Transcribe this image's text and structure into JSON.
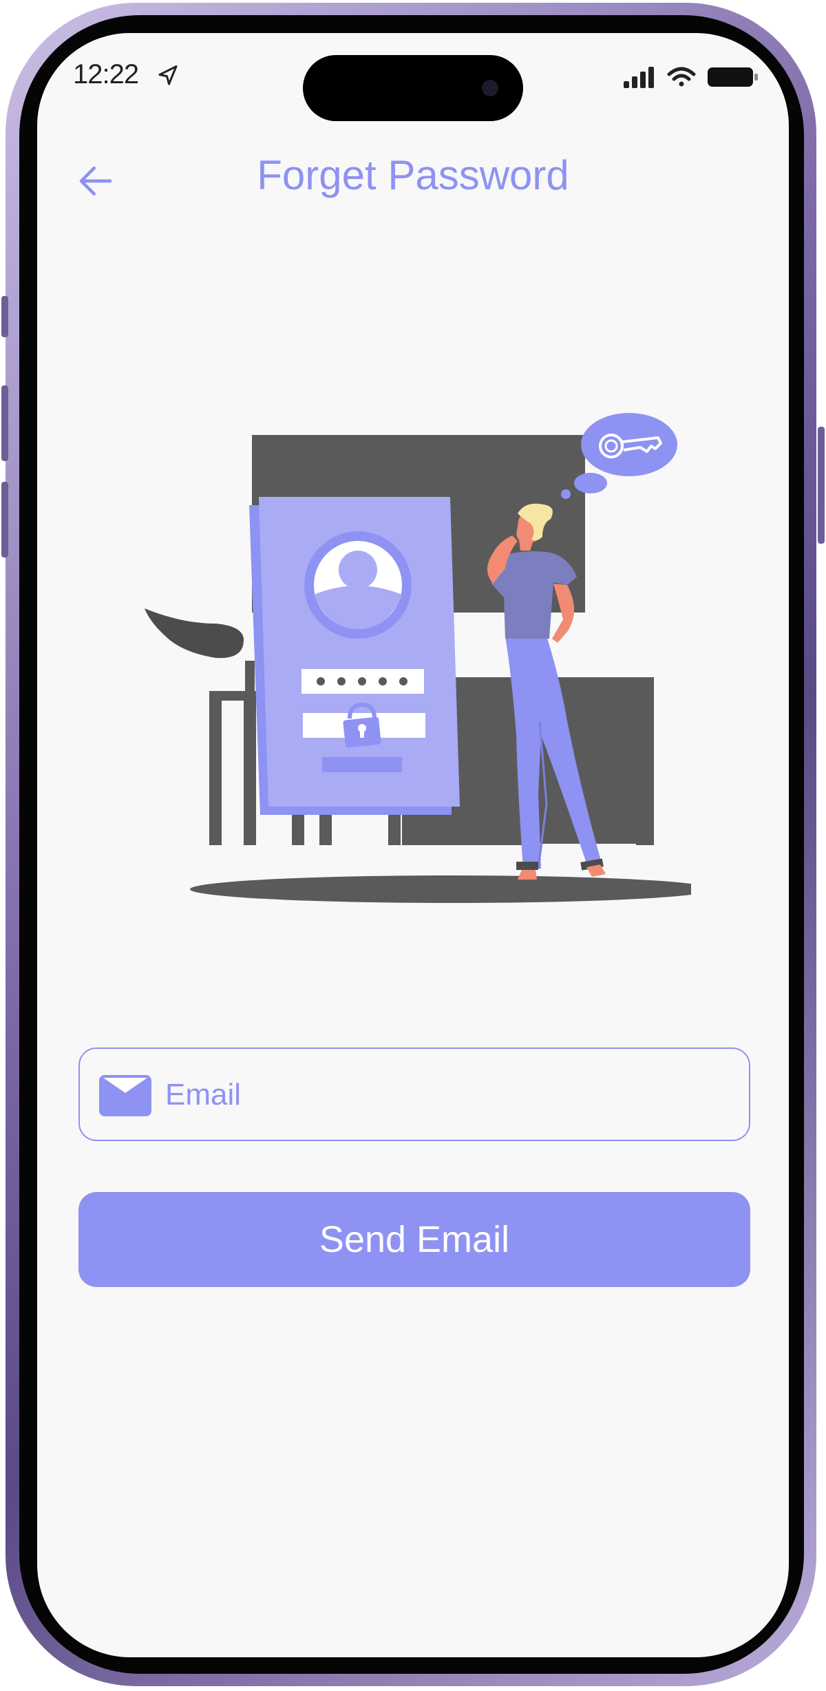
{
  "status_bar": {
    "time": "12:22",
    "location_icon": "location-arrow-icon",
    "signal_icon": "cellular-signal-icon",
    "wifi_icon": "wifi-icon",
    "battery_icon": "battery-icon"
  },
  "header": {
    "back_icon": "arrow-left-icon",
    "title": "Forget Password"
  },
  "illustration": {
    "name": "person-thinking-key-login-illustration"
  },
  "form": {
    "email": {
      "icon": "envelope-icon",
      "placeholder": "Email",
      "value": ""
    },
    "submit_label": "Send Email"
  },
  "colors": {
    "accent": "#8e92f2",
    "card": "#a9abf5",
    "dark_gray": "#5a5a5a",
    "background": "#f8f8f8"
  }
}
